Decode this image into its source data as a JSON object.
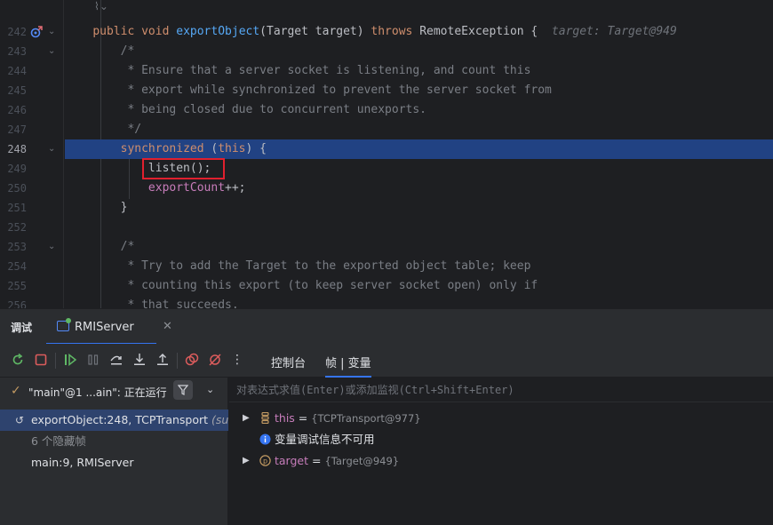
{
  "editor": {
    "lines": [
      {
        "num": "",
        "fold": false
      },
      {
        "num": "242",
        "fold": true
      },
      {
        "num": "243",
        "fold": true
      },
      {
        "num": "244",
        "fold": false
      },
      {
        "num": "245",
        "fold": false
      },
      {
        "num": "246",
        "fold": false
      },
      {
        "num": "247",
        "fold": false
      },
      {
        "num": "248",
        "fold": true
      },
      {
        "num": "249",
        "fold": false
      },
      {
        "num": "250",
        "fold": false
      },
      {
        "num": "251",
        "fold": false
      },
      {
        "num": "252",
        "fold": false
      },
      {
        "num": "253",
        "fold": true
      },
      {
        "num": "254",
        "fold": false
      },
      {
        "num": "255",
        "fold": false
      },
      {
        "num": "256",
        "fold": false
      }
    ],
    "code": {
      "l242_kw1": "public",
      "l242_kw2": "void",
      "l242_fn": "exportObject",
      "l242_params": "(Target target)",
      "l242_kw3": "throws",
      "l242_rest": "RemoteException {",
      "l242_hint": "target: Target@949",
      "l243": "/*",
      "l244": " * Ensure that a server socket is listening, and count this",
      "l245": " * export while synchronized to prevent the server socket from",
      "l246": " * being closed due to concurrent unexports.",
      "l247": " */",
      "l248_kw1": "synchronized",
      "l248_mid1": " (",
      "l248_kw2": "this",
      "l248_end": ") {",
      "l249": "listen();",
      "l250_fld": "exportCount",
      "l250_op": "++;",
      "l251": "}",
      "l253": "/*",
      "l254": " * Try to add the Target to the exported object table; keep",
      "l255": " * counting this export (to keep server socket open) only if",
      "l256": " * that succeeds."
    },
    "annotation_icon": "implementation-gutter-icon"
  },
  "debug": {
    "title": "调试",
    "run_tab": "RMIServer",
    "close_glyph": "✕",
    "tabs": {
      "console": "控制台",
      "frames_vars": "帧 | 变量"
    },
    "thread": {
      "label": "\"main\"@1 ...ain\": 正在运行"
    },
    "frames": [
      {
        "method": "exportObject:248, TCPTransport ",
        "pkg": "(sun.rmi.transport.tcp)",
        "selected": true
      },
      {
        "method": "6 个隐藏帧",
        "pkg": "",
        "selected": false
      },
      {
        "method": "main:9, RMIServer",
        "pkg": "",
        "selected": false
      }
    ],
    "eval_placeholder": "对表达式求值(Enter)或添加监视(Ctrl+Shift+Enter)",
    "variables": [
      {
        "name": "this",
        "eq": " = ",
        "value": "{TCPTransport@977}",
        "expandable": true,
        "icon": "field-icon"
      },
      {
        "name": "变量调试信息不可用",
        "eq": "",
        "value": "",
        "expandable": false,
        "icon": "info-icon"
      },
      {
        "name": "target",
        "eq": " = ",
        "value": "{Target@949}",
        "expandable": true,
        "icon": "parameter-icon"
      }
    ]
  },
  "colors": {
    "background": "#1e1f22",
    "panel": "#2b2d30",
    "selection_line": "#214283",
    "keyword": "#cf8e6d",
    "function": "#56a8f5",
    "comment": "#7a7e85",
    "field": "#c77dbb",
    "accent": "#3574f0",
    "marker": "#e0202e"
  }
}
